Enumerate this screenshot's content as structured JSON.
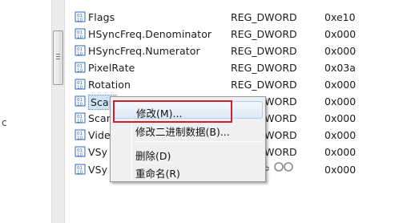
{
  "rows": [
    {
      "name": "Flags",
      "type": "REG_DWORD",
      "data": "0xe10"
    },
    {
      "name": "HSyncFreq.Denominator",
      "type": "REG_DWORD",
      "data": "0x000"
    },
    {
      "name": "HSyncFreq.Numerator",
      "type": "REG_DWORD",
      "data": "0x000"
    },
    {
      "name": "PixelRate",
      "type": "REG_DWORD",
      "data": "0x03a"
    },
    {
      "name": "Rotation",
      "type": "REG_DWORD",
      "data": "0x000"
    },
    {
      "name": "Scali",
      "type": "REG_DWORD",
      "data": "0x000"
    },
    {
      "name": "Scar",
      "type": "REG_DWORD",
      "data": "0x000"
    },
    {
      "name": "Vide",
      "type": "REG_DWORD",
      "data": "0x000"
    },
    {
      "name": "VSy",
      "type": "REG_DWORD",
      "data": "0x000"
    },
    {
      "name": "VSy",
      "type": "",
      "data": "0x000"
    }
  ],
  "context_menu": {
    "modify": "修改(M)...",
    "modify_binary": "修改二进制数据(B)...",
    "delete": "删除(D)",
    "rename": "重命名(R)"
  },
  "gutter_glyph": "c",
  "colors": {
    "selection": "#cfe3f7",
    "callout": "#d0202a",
    "icon_blue": "#2f64b8"
  }
}
